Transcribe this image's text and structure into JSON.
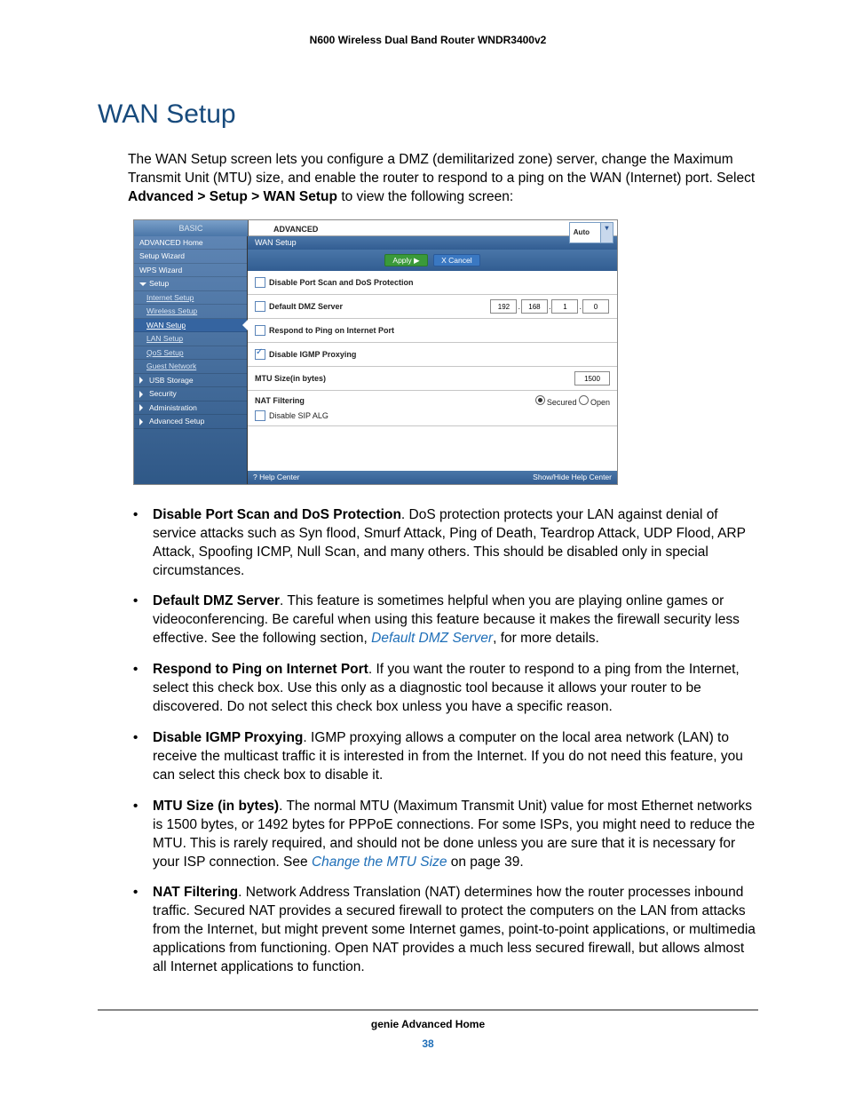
{
  "doc_header": "N600 Wireless Dual Band Router WNDR3400v2",
  "section_title": "WAN Setup",
  "intro_a": "The WAN Setup screen lets you configure a DMZ (demilitarized zone) server, change the Maximum Transmit Unit (MTU) size, and enable the router to respond to a ping on the WAN (Internet) port. Select ",
  "intro_bold": "Advanced > Setup > WAN Setup",
  "intro_b": " to view the following screen:",
  "screenshot": {
    "tab_basic": "BASIC",
    "tab_advanced": "ADVANCED",
    "auto_label": "Auto",
    "side": {
      "advanced_home": "ADVANCED Home",
      "setup_wizard": "Setup Wizard",
      "wps_wizard": "WPS Wizard",
      "setup": "Setup",
      "internet_setup": "Internet Setup",
      "wireless_setup": "Wireless Setup",
      "wan_setup": "WAN Setup",
      "lan_setup": "LAN Setup",
      "qos_setup": "QoS Setup",
      "guest_network": "Guest Network",
      "usb_storage": "USB Storage",
      "security": "Security",
      "administration": "Administration",
      "advanced_setup": "Advanced Setup"
    },
    "panel": {
      "title": "WAN Setup",
      "apply": "Apply ▶",
      "cancel": "X Cancel",
      "row1": "Disable Port Scan and DoS Protection",
      "row2": "Default DMZ Server",
      "ip": {
        "a": "192",
        "b": "168",
        "c": "1",
        "d": "0"
      },
      "row3": "Respond to Ping on Internet Port",
      "row4": "Disable IGMP Proxying",
      "row5": "MTU Size(in bytes)",
      "mtu_val": "1500",
      "nat": "NAT Filtering",
      "nat_secured": "Secured",
      "nat_open": "Open",
      "sip": "Disable SIP ALG",
      "help_left": "? Help Center",
      "help_right": "Show/Hide Help Center"
    }
  },
  "items": [
    {
      "name": "Disable Port Scan and DoS Protection",
      "text": ". DoS protection protects your LAN against denial of service attacks such as Syn flood, Smurf Attack, Ping of Death, Teardrop Attack, UDP Flood, ARP Attack, Spoofing ICMP, Null Scan, and many others. This should be disabled only in special circumstances."
    },
    {
      "name": "Default DMZ Server",
      "text_a": ". This feature is sometimes helpful when you are playing online games or videoconferencing. Be careful when using this feature because it makes the firewall security less effective. See the following section, ",
      "link": "Default DMZ Server",
      "text_b": ", for more details."
    },
    {
      "name": "Respond to Ping on Internet Port",
      "text": ". If you want the router to respond to a ping from the Internet, select this check box. Use this only as a diagnostic tool because it allows your router to be discovered. Do not select this check box unless you have a specific reason."
    },
    {
      "name": "Disable IGMP Proxying",
      "text": ". IGMP proxying allows a computer on the local area network (LAN) to receive the multicast traffic it is interested in from the Internet. If you do not need this feature, you can select this check box to disable it."
    },
    {
      "name": "MTU Size (in bytes)",
      "text_a": ". The normal MTU (Maximum Transmit Unit) value for most Ethernet networks is 1500 bytes, or 1492 bytes for PPPoE connections. For some ISPs, you might need to reduce the MTU. This is rarely required, and should not be done unless you are sure that it is necessary for your ISP connection. See ",
      "link": "Change the MTU Size",
      "text_b": " on page 39."
    },
    {
      "name": "NAT Filtering",
      "text": ". Network Address Translation (NAT) determines how the router processes inbound traffic. Secured NAT provides a secured firewall to protect the computers on the LAN from attacks from the Internet, but might prevent some Internet games, point-to-point applications, or multimedia applications from functioning. Open NAT provides a much less secured firewall, but allows almost all Internet applications to function."
    }
  ],
  "footer_title": "genie Advanced Home",
  "footer_page": "38"
}
